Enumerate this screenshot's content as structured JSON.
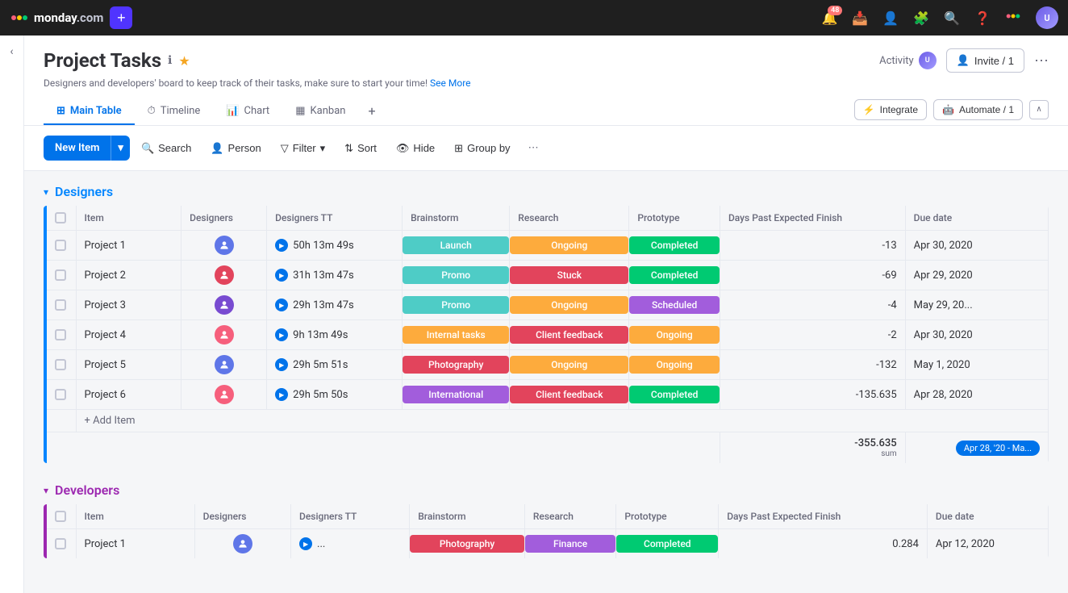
{
  "app": {
    "name": "monday",
    "domain": ".com"
  },
  "topnav": {
    "notification_count": "48",
    "icons": [
      "bell",
      "inbox",
      "person-plus",
      "puzzle",
      "search",
      "help",
      "color-logo",
      "avatar"
    ]
  },
  "board": {
    "title": "Project Tasks",
    "description": "Designers and developers' board to keep track of their tasks, make sure to start your time!",
    "see_more": "See More",
    "activity_label": "Activity",
    "invite_label": "Invite / 1"
  },
  "tabs": [
    {
      "label": "Main Table",
      "icon": "table",
      "active": true
    },
    {
      "label": "Timeline",
      "icon": "timeline",
      "active": false
    },
    {
      "label": "Chart",
      "icon": "chart",
      "active": false
    },
    {
      "label": "Kanban",
      "icon": "kanban",
      "active": false
    }
  ],
  "tab_actions": {
    "integrate": "Integrate",
    "automate": "Automate / 1"
  },
  "toolbar": {
    "new_item": "New Item",
    "search": "Search",
    "person": "Person",
    "filter": "Filter",
    "sort": "Sort",
    "hide": "Hide",
    "group_by": "Group by"
  },
  "designers_group": {
    "title": "Designers",
    "columns": [
      "Item",
      "Designers",
      "Designers TT",
      "Brainstorm",
      "Research",
      "Prototype",
      "Days Past Expected Finish",
      "Due date"
    ],
    "rows": [
      {
        "name": "Project 1",
        "designer_color": "#5f76e8",
        "time": "50h 13m 49s",
        "brainstorm": {
          "label": "Launch",
          "color": "#4eccc6"
        },
        "research": {
          "label": "Ongoing",
          "color": "#fdab3d"
        },
        "prototype": {
          "label": "Completed",
          "color": "#00ca72"
        },
        "days_past": "-13",
        "due_date": "Apr 30, 2020"
      },
      {
        "name": "Project 2",
        "designer_color": "#e2445c",
        "time": "31h 13m 47s",
        "brainstorm": {
          "label": "Promo",
          "color": "#4eccc6"
        },
        "research": {
          "label": "Stuck",
          "color": "#e2445c"
        },
        "prototype": {
          "label": "Completed",
          "color": "#00ca72"
        },
        "days_past": "-69",
        "due_date": "Apr 29, 2020"
      },
      {
        "name": "Project 3",
        "designer_color": "#784bd1",
        "time": "29h 13m 47s",
        "brainstorm": {
          "label": "Promo",
          "color": "#4eccc6"
        },
        "research": {
          "label": "Ongoing",
          "color": "#fdab3d"
        },
        "prototype": {
          "label": "Scheduled",
          "color": "#a25ddc"
        },
        "days_past": "-4",
        "due_date": "May 29, 20..."
      },
      {
        "name": "Project 4",
        "designer_color": "#f65f7c",
        "time": "9h 13m 49s",
        "brainstorm": {
          "label": "Internal tasks",
          "color": "#fdab3d"
        },
        "research": {
          "label": "Client feedback",
          "color": "#e2445c"
        },
        "prototype": {
          "label": "Ongoing",
          "color": "#fdab3d"
        },
        "days_past": "-2",
        "due_date": "Apr 30, 2020"
      },
      {
        "name": "Project 5",
        "designer_color": "#5f76e8",
        "time": "29h 5m 51s",
        "brainstorm": {
          "label": "Photography",
          "color": "#e2445c"
        },
        "research": {
          "label": "Ongoing",
          "color": "#fdab3d"
        },
        "prototype": {
          "label": "Ongoing",
          "color": "#fdab3d"
        },
        "days_past": "-132",
        "due_date": "May 1, 2020"
      },
      {
        "name": "Project 6",
        "designer_color": "#f65f7c",
        "time": "29h 5m 50s",
        "brainstorm": {
          "label": "International",
          "color": "#a25ddc"
        },
        "research": {
          "label": "Client feedback",
          "color": "#e2445c"
        },
        "prototype": {
          "label": "Completed",
          "color": "#00ca72"
        },
        "days_past": "-135.635",
        "due_date": "Apr 28, 2020"
      }
    ],
    "add_item": "+ Add Item",
    "summary": {
      "days_past_sum": "-355.635",
      "days_past_label": "sum",
      "date_range": "Apr 28, '20 - Ma..."
    }
  },
  "developers_group": {
    "title": "Developers",
    "columns": [
      "Item",
      "Designers",
      "Designers TT",
      "Brainstorm",
      "Research",
      "Prototype",
      "Days Past Expected Finish",
      "Due date"
    ],
    "rows": [
      {
        "name": "Project 1",
        "designer_color": "#5f76e8",
        "time": "...",
        "brainstorm": {
          "label": "Photography",
          "color": "#e2445c"
        },
        "research": {
          "label": "Finance",
          "color": "#a25ddc"
        },
        "prototype": {
          "label": "Completed",
          "color": "#00ca72"
        },
        "days_past": "0.284",
        "due_date": "Apr 12, 2020"
      }
    ]
  },
  "colors": {
    "designers_accent": "#0085ff",
    "developers_accent": "#9c27b0",
    "primary": "#0073ea"
  }
}
